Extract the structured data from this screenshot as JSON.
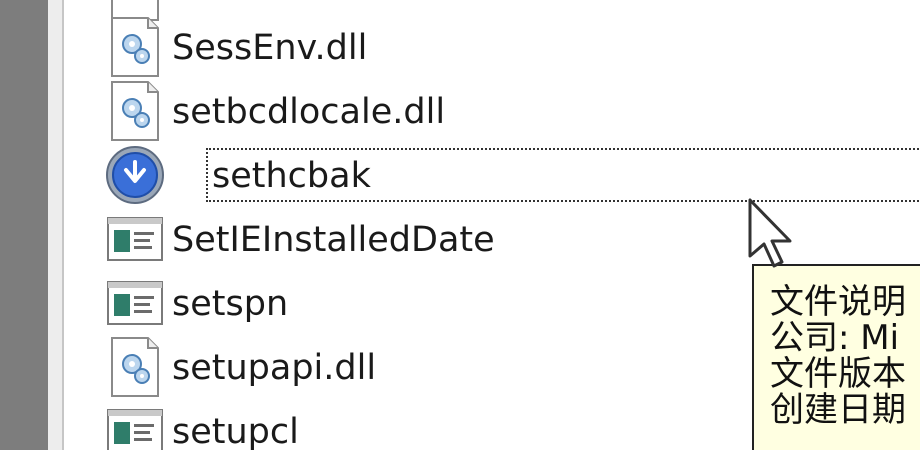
{
  "file_list": {
    "items": [
      {
        "label": "SessEnv.dll",
        "icon": "dll-file-icon"
      },
      {
        "label": "setbcdlocale.dll",
        "icon": "dll-file-icon"
      },
      {
        "label": "sethcbak",
        "icon": "setup-app-icon",
        "selected": true
      },
      {
        "label": "SetIEInstalledDate",
        "icon": "window-app-icon"
      },
      {
        "label": "setspn",
        "icon": "window-app-icon"
      },
      {
        "label": "setupapi.dll",
        "icon": "dll-file-icon"
      },
      {
        "label": "setupcl",
        "icon": "window-app-icon"
      }
    ]
  },
  "tooltip": {
    "line1": "文件说明",
    "line2": "公司: Mi",
    "line3": "文件版本",
    "line4": "创建日期"
  },
  "colors": {
    "tooltip_bg": "#ffffe1",
    "left_pane": "#7d7d7d",
    "text": "#1a1a1a"
  }
}
